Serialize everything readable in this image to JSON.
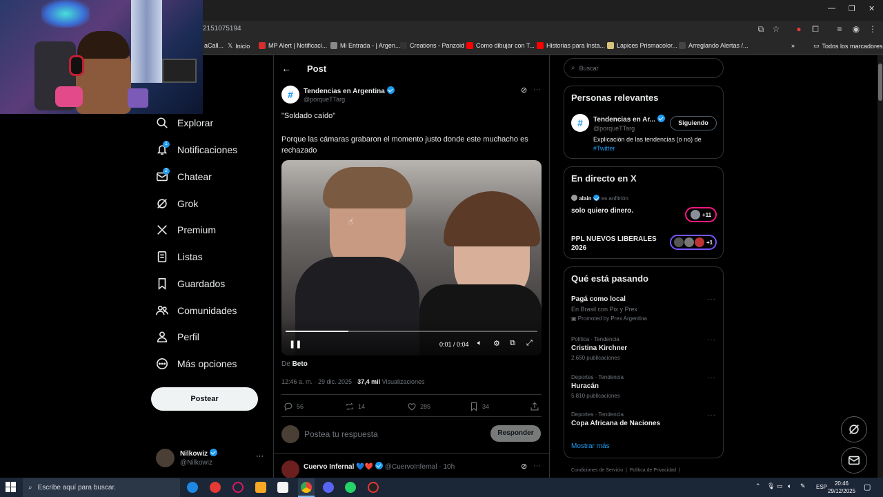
{
  "browser": {
    "url": "2151075194",
    "bookmarks": [
      "aCall...",
      "Inicio",
      "MP Alert | Notificaci...",
      "Mi Entrada - | Argen...",
      "Creations - Panzoid",
      "Como dibujar con T...",
      "Historias para Insta...",
      "Lapices Prismacolor...",
      "Arreglando Alertas /..."
    ],
    "bookmarks_all": "Todos los marcadores",
    "more": "»"
  },
  "nav": {
    "items": [
      {
        "label": "Explorar",
        "icon": "search-icon"
      },
      {
        "label": "Notificaciones",
        "icon": "bell-icon",
        "badge": "1"
      },
      {
        "label": "Chatear",
        "icon": "mail-icon",
        "badge": "2"
      },
      {
        "label": "Grok",
        "icon": "grok-icon"
      },
      {
        "label": "Premium",
        "icon": "x-logo-icon"
      },
      {
        "label": "Listas",
        "icon": "list-icon"
      },
      {
        "label": "Guardados",
        "icon": "bookmark-icon"
      },
      {
        "label": "Comunidades",
        "icon": "people-icon"
      },
      {
        "label": "Perfil",
        "icon": "person-icon"
      },
      {
        "label": "Más opciones",
        "icon": "more-circle-icon"
      }
    ],
    "post_button": "Postear",
    "account": {
      "name": "Nilkowiz",
      "handle": "@Nilkowiz",
      "more": "···"
    }
  },
  "post": {
    "header_title": "Post",
    "author_name": "Tendencias en Argentina",
    "author_handle": "@porqueTTarg",
    "text_line1": "\"Soldado caído\"",
    "text_line2": "Porque las cámaras grabaron el momento justo donde este muchacho es rechazado",
    "video_time": "0:01 / 0:04",
    "video_progress": 0.25,
    "from_label": "De",
    "from_name": "Beto",
    "meta_date": "12:46 a. m. · 29 dic. 2025 ·",
    "views_count": "37,4 mil",
    "views_label": "Visualizaciones",
    "replies": "56",
    "reposts": "14",
    "likes": "285",
    "bookmarks": "34",
    "reply_placeholder": "Postea tu respuesta",
    "reply_button": "Responder",
    "next_author": "Cuervo Infernal",
    "next_emojis": "💙❤️",
    "next_handle_time": "@CuervoInfernal · 10h"
  },
  "right": {
    "search_placeholder": "Buscar",
    "relevant_title": "Personas relevantes",
    "relevant_name": "Tendencias en Ar...",
    "relevant_handle": "@porqueTTarg",
    "relevant_follow": "Siguiendo",
    "relevant_bio": "Explicación de las tendencias (o no) de",
    "relevant_hashtag": "#Twitter",
    "live_title": "En directo en X",
    "live_host": "alain",
    "live_host_label": "es anfitrión",
    "live_space1": "solo quiero dinero.",
    "live_space1_count": "+11",
    "live_space2": "PPL NUEVOS LIBERALES 2026",
    "live_space2_count": "+1",
    "happening_title": "Qué está pasando",
    "ad_title": "Pagá como local",
    "ad_sub": "En Brasil con Pix y Prex",
    "ad_promoted": "Promoted by Prex Argentina",
    "trends": [
      {
        "cat": "Política · Tendencia",
        "title": "Cristina Kirchner",
        "count": "2.650 publicaciones"
      },
      {
        "cat": "Deportes · Tendencia",
        "title": "Huracán",
        "count": "5.810 publicaciones"
      },
      {
        "cat": "Deportes · Tendencia",
        "title": "Copa Africana de Naciones",
        "count": ""
      }
    ],
    "show_more": "Mostrar más",
    "footer1": "Condiciones de Servicio",
    "footer2": "Política de Privacidad"
  },
  "taskbar": {
    "search_placeholder": "Escribe aquí para buscar.",
    "lang": "ESP",
    "time": "20:46",
    "date": "29/12/2025"
  },
  "colors": {
    "accent": "#1d9bf0",
    "background": "#000000",
    "border": "#2f3336",
    "muted": "#71767b",
    "live_pink": "#f91880",
    "live_purple": "#7856ff"
  }
}
